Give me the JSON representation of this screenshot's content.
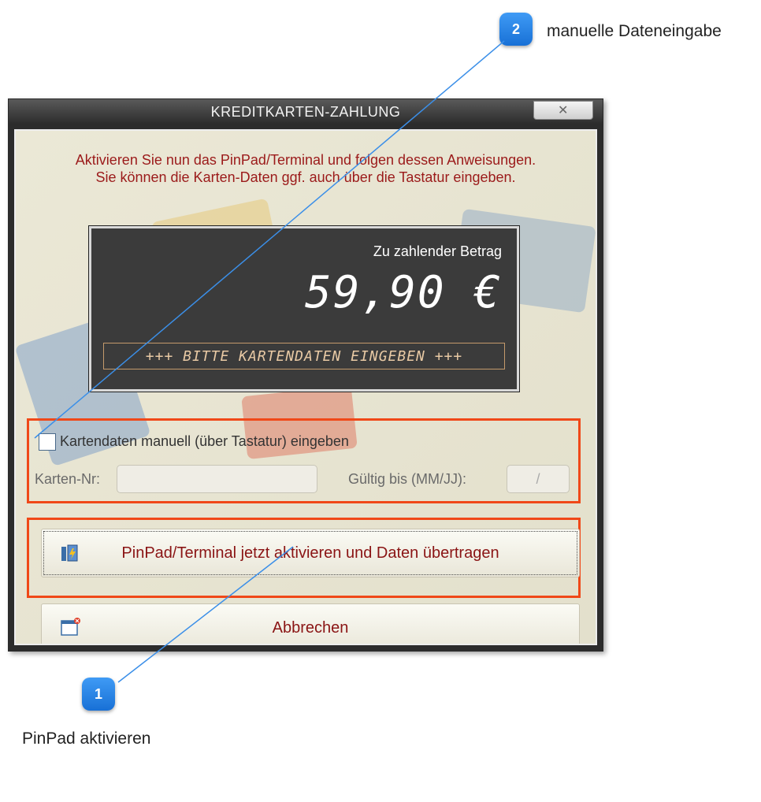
{
  "callouts": [
    {
      "number": "2",
      "text": "manuelle Dateneingabe"
    },
    {
      "number": "1",
      "text": "PinPad aktivieren"
    }
  ],
  "dialog": {
    "title": "KREDITKARTEN-ZAHLUNG",
    "close_glyph": "✕",
    "instructions": [
      "Aktivieren Sie nun das PinPad/Terminal und folgen dessen Anweisungen.",
      "Sie können die Karten-Daten ggf. auch über die Tastatur eingeben."
    ],
    "display": {
      "label": "Zu zahlender Betrag",
      "amount": "59,90 €",
      "status": "+++ BITTE KARTENDATEN EINGEBEN +++"
    },
    "manual_entry": {
      "checkbox_label": "Kartendaten manuell (über Tastatur) eingeben",
      "checked": false,
      "card_number_label": "Karten-Nr:",
      "card_number_value": "",
      "expiry_label": "Gültig bis (MM/JJ):",
      "expiry_value": "/"
    },
    "buttons": {
      "activate_label": "PinPad/Terminal jetzt aktivieren und Daten übertragen",
      "cancel_label": "Abbrechen"
    }
  },
  "colors": {
    "callout_blue": "#2a86ea",
    "highlight": "#f04818",
    "instruction_text": "#9b1a1a",
    "button_text": "#8a1414"
  }
}
